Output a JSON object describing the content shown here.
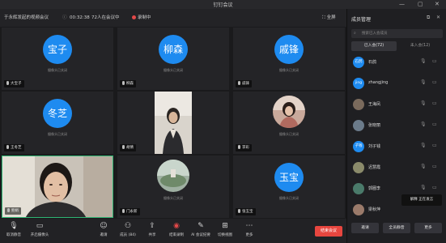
{
  "window": {
    "title": "钉钉会议",
    "min": "—",
    "max": "▢",
    "close": "✕"
  },
  "meeting": {
    "title": "于永辉发起的视频会议",
    "duration": "00:32:38",
    "online": "72人在会议中",
    "recording": "录制中",
    "fullscreen": "全屏"
  },
  "tiles": [
    {
      "avatar_text": "宝子",
      "name": "大宝子",
      "status": "摄像头已关闭"
    },
    {
      "avatar_text": "柳森",
      "name": "柳森",
      "status": "摄像头已关闭"
    },
    {
      "avatar_text": "戚锋",
      "name": "戚锋",
      "status": "摄像头已关闭"
    },
    {
      "avatar_text": "冬芝",
      "name": "王冬芝",
      "status": "摄像头已关闭"
    },
    {
      "avatar_text": "",
      "name": "胡倩",
      "status": ""
    },
    {
      "avatar_text": "",
      "name": "李彩",
      "status": "摄像头已关闭"
    },
    {
      "avatar_text": "",
      "name": "鲍娟",
      "status": ""
    },
    {
      "avatar_text": "",
      "name": "门永新",
      "status": "摄像头已关闭"
    },
    {
      "avatar_text": "玉宝",
      "name": "张玉宝",
      "status": "摄像头已关闭"
    }
  ],
  "toolbar": {
    "mute": "取消静音",
    "camera": "开启摄像头",
    "invite": "邀请",
    "members": "成员 (84)",
    "share": "共享",
    "end_record": "结束录制",
    "ai": "AI 会议纪要",
    "layout": "切换视图",
    "more": "更多",
    "leave": "结束会议"
  },
  "panel": {
    "title": "成员管理",
    "search_placeholder": "搜索已入会成员",
    "tab_joined": "已入会(72)",
    "tab_not_joined": "未入会(12)",
    "members": [
      {
        "avatar": "石鸽",
        "name": "石鸽",
        "color": "#1e8bf0"
      },
      {
        "avatar": "jing",
        "name": "zhangjing",
        "color": "#1e8bf0"
      },
      {
        "avatar": "",
        "name": "王海凤",
        "color": "#7a6a5c"
      },
      {
        "avatar": "",
        "name": "张晓丽",
        "color": "#6b7b8a"
      },
      {
        "avatar": "子钱",
        "name": "刘子钱",
        "color": "#1e8bf0"
      },
      {
        "avatar": "",
        "name": "迟慧霞",
        "color": "#8a8a6a"
      },
      {
        "avatar": "",
        "name": "郭圈李",
        "color": "#4a7a6a"
      },
      {
        "avatar": "",
        "name": "梁秋萍",
        "color": "#9a7a6a"
      }
    ],
    "tooltip": "解释  正在发言",
    "btn_invite": "邀请",
    "btn_mute_all": "全员静音",
    "btn_more": "更多"
  }
}
